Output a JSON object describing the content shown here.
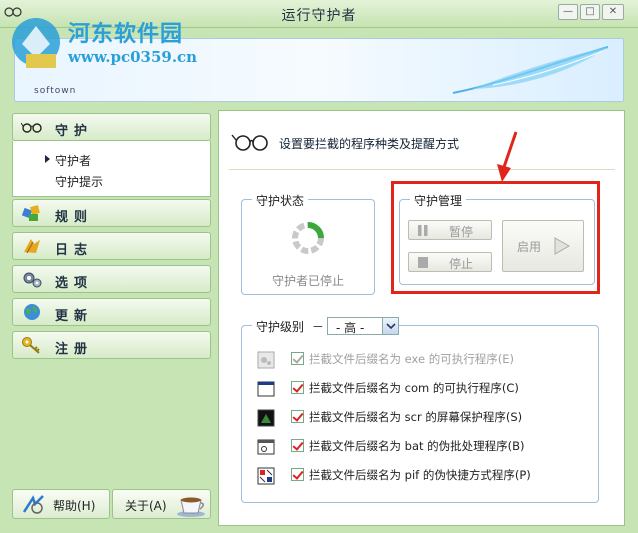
{
  "window": {
    "title": "运行守护者",
    "controls": [
      "minimize",
      "maximize",
      "close"
    ]
  },
  "watermark": {
    "site_name": "河东软件园",
    "url": "www.pc0359.cn",
    "brand": "softown"
  },
  "sidebar": {
    "items": [
      {
        "label": "守护",
        "icon": "glasses-icon"
      },
      {
        "label": "规则",
        "icon": "rules-icon"
      },
      {
        "label": "日志",
        "icon": "log-icon"
      },
      {
        "label": "选项",
        "icon": "gear-icon"
      },
      {
        "label": "更新",
        "icon": "globe-icon"
      },
      {
        "label": "注册",
        "icon": "key-icon"
      }
    ],
    "subitems": [
      "守护者",
      "守护提示"
    ],
    "help_button": "帮助(H)",
    "about_button": "关于(A)"
  },
  "main": {
    "header": "设置要拦截的程序种类及提醒方式",
    "status_group": {
      "title": "守护状态",
      "status_text": "守护者已停止"
    },
    "manage_group": {
      "title": "守护管理",
      "pause_label": "暂停",
      "stop_label": "停止",
      "enable_label": "启用"
    },
    "level_group": {
      "title": "守护级别",
      "dash": "－",
      "selected_level": "- 高 -"
    },
    "rules": [
      {
        "label": "拦截文件后缀名为 exe 的可执行程序(E)",
        "checked": true,
        "disabled": true
      },
      {
        "label": "拦截文件后缀名为 com 的可执行程序(C)",
        "checked": true,
        "disabled": false
      },
      {
        "label": "拦截文件后缀名为 scr 的屏幕保护程序(S)",
        "checked": true,
        "disabled": false
      },
      {
        "label": "拦截文件后缀名为 bat 的伪批处理程序(B)",
        "checked": true,
        "disabled": false
      },
      {
        "label": "拦截文件后缀名为 pif 的伪快捷方式程序(P)",
        "checked": true,
        "disabled": false
      }
    ]
  },
  "colors": {
    "background": "#c7e4b4",
    "highlight_box": "#e0261c",
    "watermark": "#2a9fd8"
  }
}
